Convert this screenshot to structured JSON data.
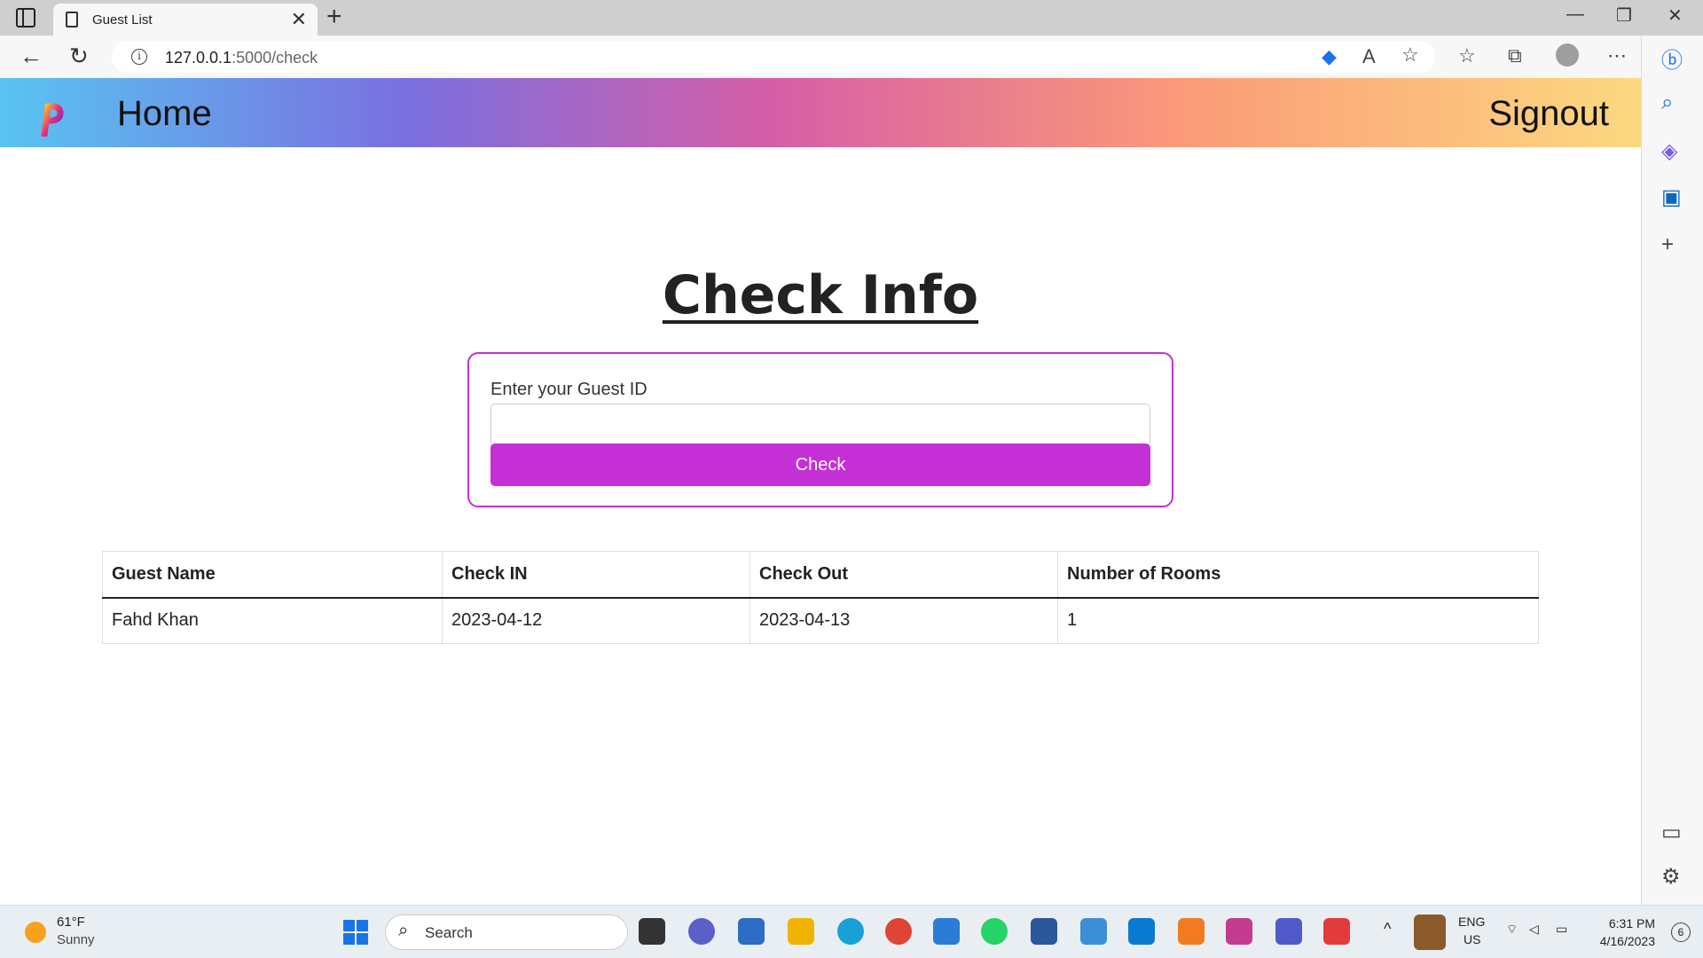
{
  "browser": {
    "tab_title": "Guest List",
    "url_host": "127.0.0.1",
    "url_rest": ":5000/check",
    "new_tab": "+",
    "close_tab": "✕"
  },
  "navbar": {
    "home_label": "Home",
    "signout_label": "Signout"
  },
  "main": {
    "heading": "Check Info",
    "form": {
      "label": "Enter your Guest ID",
      "input_value": "",
      "button_label": "Check"
    },
    "table": {
      "headers": [
        "Guest Name",
        "Check IN",
        "Check Out",
        "Number of Rooms"
      ],
      "rows": [
        [
          "Fahd Khan",
          "2023-04-12",
          "2023-04-13",
          "1"
        ]
      ]
    }
  },
  "taskbar": {
    "weather_temp": "61°F",
    "weather_desc": "Sunny",
    "search_label": "Search",
    "lang_line1": "ENG",
    "lang_line2": "US",
    "time": "6:31 PM",
    "date": "4/16/2023",
    "notification_count": "6"
  },
  "colors": {
    "accent": "#c530d6",
    "card_border": "#c130cf"
  }
}
